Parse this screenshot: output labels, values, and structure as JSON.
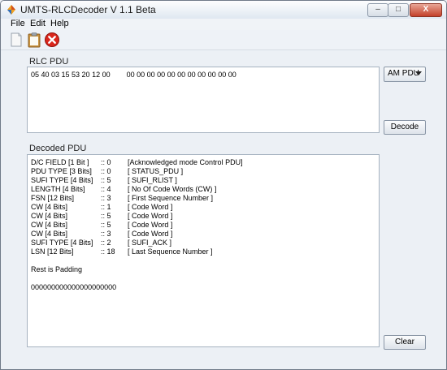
{
  "window": {
    "title": "UMTS-RLCDecoder V 1.1 Beta",
    "minimize_glyph": "–",
    "maximize_glyph": "□",
    "close_glyph": "X"
  },
  "menu": {
    "file": "File",
    "edit": "Edit",
    "help": "Help"
  },
  "toolbar": {
    "icons": [
      "new-document-icon",
      "clipboard-icon",
      "close-circle-icon"
    ],
    "accent_red": "#d9261c"
  },
  "rlc_pdu": {
    "label": "RLC PDU",
    "value": "05 40 03 15 53 20 12 00        00 00 00 00 00 00 00 00 00 00 00",
    "pdu_type_select": "AM PDU",
    "decode_label": "Decode"
  },
  "decoded_pdu": {
    "label": "Decoded PDU",
    "rows": [
      {
        "field": "D/C FIELD [1 Bit ]",
        "value": ":: 0",
        "desc": "[Acknowledged mode Control PDU]"
      },
      {
        "field": "PDU TYPE [3 Bits]",
        "value": ":: 0",
        "desc": "[ STATUS_PDU ]"
      },
      {
        "field": "SUFI TYPE [4 Bits]",
        "value": ":: 5",
        "desc": "[ SUFI_RLIST ]"
      },
      {
        "field": "LENGTH [4 Bits]",
        "value": ":: 4",
        "desc": "[ No Of Code Words (CW) ]"
      },
      {
        "field": "FSN [12 Bits]",
        "value": ":: 3",
        "desc": "[ First Sequence Number ]"
      },
      {
        "field": "CW [4 Bits]",
        "value": ":: 1",
        "desc": "[ Code Word ]"
      },
      {
        "field": "CW [4 Bits]",
        "value": ":: 5",
        "desc": "[ Code Word ]"
      },
      {
        "field": "CW [4 Bits]",
        "value": ":: 5",
        "desc": "[ Code Word ]"
      },
      {
        "field": "CW [4 Bits]",
        "value": ":: 3",
        "desc": "[ Code Word ]"
      },
      {
        "field": "SUFI TYPE [4 Bits]",
        "value": ":: 2",
        "desc": "[ SUFI_ACK ]"
      },
      {
        "field": "LSN [12 Bits]",
        "value": ":: 18",
        "desc": "[ Last Sequence Number ]"
      }
    ],
    "rest_text": "Rest is Padding",
    "padding_bits": "000000000000000000000",
    "clear_label": "Clear"
  }
}
